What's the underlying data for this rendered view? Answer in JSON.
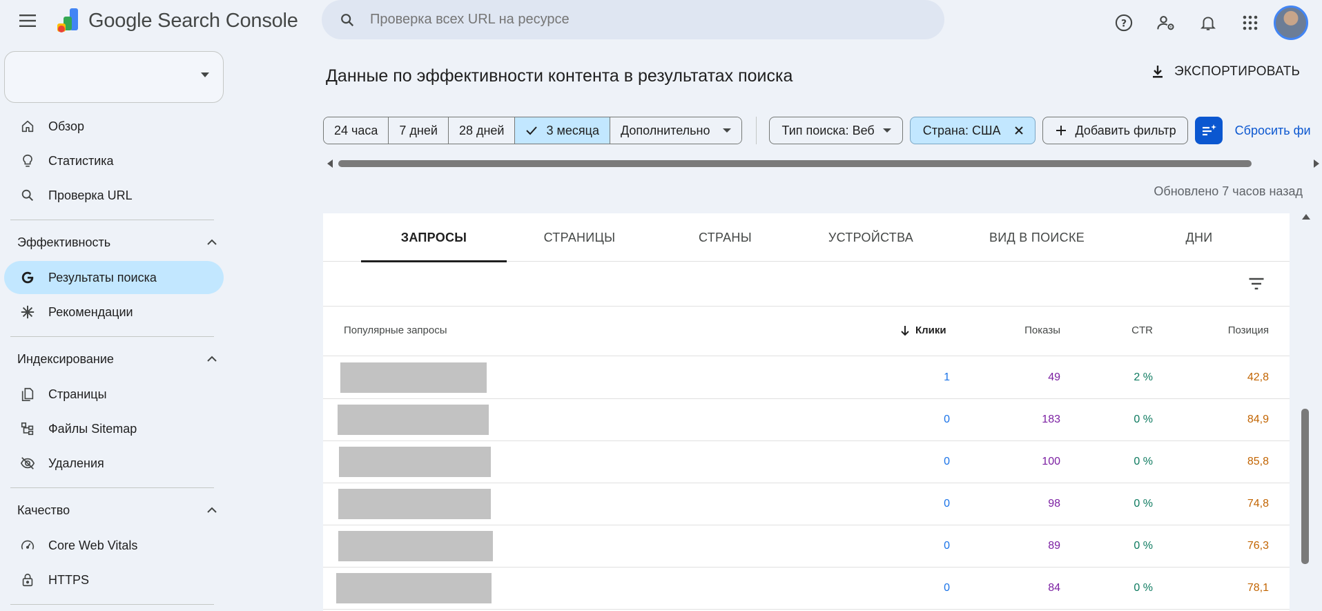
{
  "app": {
    "title": "Google Search Console"
  },
  "search": {
    "placeholder": "Проверка всех URL на ресурсе"
  },
  "sidebar": {
    "top_items": [
      {
        "label": "Обзор",
        "icon": "home-icon"
      },
      {
        "label": "Статистика",
        "icon": "lightbulb-icon"
      },
      {
        "label": "Проверка URL",
        "icon": "search-icon"
      }
    ],
    "sections": [
      {
        "title": "Эффективность",
        "items": [
          {
            "label": "Результаты поиска",
            "icon": "google-g-icon",
            "active": true
          },
          {
            "label": "Рекомендации",
            "icon": "asterisk-icon"
          }
        ]
      },
      {
        "title": "Индексирование",
        "items": [
          {
            "label": "Страницы",
            "icon": "pages-icon"
          },
          {
            "label": "Файлы Sitemap",
            "icon": "sitemap-icon"
          },
          {
            "label": "Удаления",
            "icon": "eye-off-icon"
          }
        ]
      },
      {
        "title": "Качество",
        "items": [
          {
            "label": "Core Web Vitals",
            "icon": "gauge-icon"
          },
          {
            "label": "HTTPS",
            "icon": "lock-icon"
          }
        ]
      }
    ]
  },
  "main": {
    "title": "Данные по эффективности контента в результатах поиска",
    "export_label": "ЭКСПОРТИРОВАТЬ",
    "date_ranges": [
      "24 часа",
      "7 дней",
      "28 дней",
      "3 месяца",
      "Дополнительно"
    ],
    "selected_range": "3 месяца",
    "chips": {
      "search_type": "Тип поиска: Веб",
      "country": "Страна: США",
      "add_filter": "Добавить фильтр"
    },
    "reset_label": "Сбросить фи",
    "updated": "Обновлено 7 часов назад",
    "tabs": [
      "ЗАПРОСЫ",
      "СТРАНИЦЫ",
      "СТРАНЫ",
      "УСТРОЙСТВА",
      "ВИД В ПОИСКЕ",
      "ДНИ"
    ],
    "active_tab": "ЗАПРОСЫ",
    "table": {
      "headers": {
        "query": "Популярные запросы",
        "clicks": "Клики",
        "impressions": "Показы",
        "ctr": "CTR",
        "position": "Позиция"
      },
      "rows": [
        {
          "clicks": "1",
          "impressions": "49",
          "ctr": "2 %",
          "position": "42,8"
        },
        {
          "clicks": "0",
          "impressions": "183",
          "ctr": "0 %",
          "position": "84,9"
        },
        {
          "clicks": "0",
          "impressions": "100",
          "ctr": "0 %",
          "position": "85,8"
        },
        {
          "clicks": "0",
          "impressions": "98",
          "ctr": "0 %",
          "position": "74,8"
        },
        {
          "clicks": "0",
          "impressions": "89",
          "ctr": "0 %",
          "position": "76,3"
        },
        {
          "clicks": "0",
          "impressions": "84",
          "ctr": "0 %",
          "position": "78,1"
        }
      ]
    }
  },
  "colors": {
    "clicks": "#1a73e8",
    "impressions": "#7b1fa2",
    "ctr": "#0d7a5f",
    "position": "#c26401",
    "accent": "#0b57d0",
    "selected": "#c2e7ff"
  }
}
